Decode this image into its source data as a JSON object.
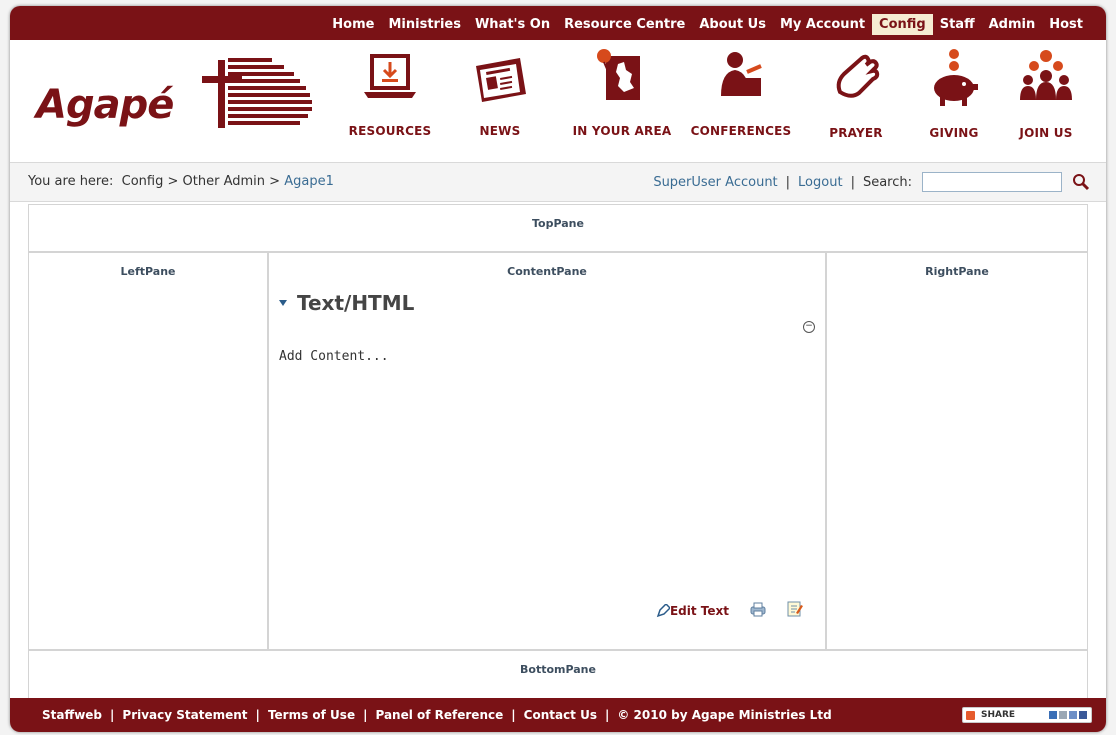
{
  "topnav": {
    "items": [
      "Home",
      "Ministries",
      "What's On",
      "Resource Centre",
      "About Us",
      "My Account",
      "Config",
      "Staff",
      "Admin",
      "Host"
    ],
    "active": "Config"
  },
  "logo": {
    "text": "Agapé"
  },
  "navicons": [
    {
      "label": "RESOURCES",
      "icon": "laptop-download-icon"
    },
    {
      "label": "NEWS",
      "icon": "newspaper-icon"
    },
    {
      "label": "IN YOUR AREA",
      "icon": "uk-map-pin-icon"
    },
    {
      "label": "CONFERENCES",
      "icon": "speaker-podium-icon"
    },
    {
      "label": "PRAYER",
      "icon": "praying-hands-icon"
    },
    {
      "label": "GIVING",
      "icon": "piggy-bank-icon"
    },
    {
      "label": "JOIN US",
      "icon": "group-people-icon"
    }
  ],
  "breadcrumb": {
    "prefix": "You are here:",
    "items": [
      "Config",
      "Other Admin",
      "Agape1"
    ],
    "separator": ">"
  },
  "util": {
    "account_link": "SuperUser Account",
    "logout_link": "Logout",
    "search_label": "Search:",
    "search_value": ""
  },
  "panes": {
    "top": "TopPane",
    "left": "LeftPane",
    "content": "ContentPane",
    "right": "RightPane",
    "bottom": "BottomPane"
  },
  "module": {
    "title": "Text/HTML",
    "body": "Add Content...",
    "edit_label": "Edit Text"
  },
  "footer": {
    "links": [
      "Staffweb",
      "Privacy Statement",
      "Terms of Use",
      "Panel of Reference",
      "Contact Us",
      "© 2010 by Agape Ministries Ltd"
    ],
    "share_label": "SHARE"
  },
  "colors": {
    "brand": "#7a1216",
    "link": "#3a6c93",
    "active_tab_bg": "#f6ecd2"
  }
}
